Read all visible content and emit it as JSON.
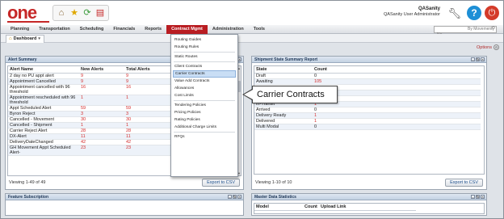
{
  "header": {
    "logo": "one",
    "user_name": "QASanity",
    "user_role": "QASanity User Administrator"
  },
  "menu": {
    "items": [
      "Planning",
      "Transportation",
      "Scheduling",
      "Financials",
      "Reports",
      "Contract Mgmt",
      "Administration",
      "Tools"
    ],
    "active": "Contract Mgmt",
    "search_placeholder": "By Movement No"
  },
  "tab": {
    "label": "Dashboard"
  },
  "options_label": "Options",
  "alert_summary": {
    "title": "Alert Summary",
    "columns": [
      "Alert Name",
      "New Alerts",
      "Total Alerts"
    ],
    "rows": [
      [
        "2 day no PU appt alert",
        "9",
        "9"
      ],
      [
        "Appointment Cancelled",
        "9",
        "9"
      ],
      [
        "Appointment cancelled with 96 threshold",
        "16",
        "16"
      ],
      [
        "Appointment rescheduled with 96 threshold",
        "1",
        "1"
      ],
      [
        "Appt Scheduled Alert",
        "59",
        "59"
      ],
      [
        "Byron Reject",
        "3",
        "3"
      ],
      [
        "Cancelled - Movement",
        "30",
        "30"
      ],
      [
        "Cancelled - Shipment",
        "1",
        "1"
      ],
      [
        "Carrier Reject Alert",
        "28",
        "28"
      ],
      [
        "DX-Alert",
        "11",
        "11"
      ],
      [
        "DeliveryDateChanged",
        "42",
        "42"
      ],
      [
        "GH Movement Appt Scheduled Alert-",
        "23",
        "23"
      ]
    ],
    "viewing": "Viewing 1-49 of 49",
    "export": "Export to CSV"
  },
  "shipment_summary": {
    "title": "Shipment State Summary Report",
    "columns": [
      "State",
      "Count"
    ],
    "rows": [
      [
        "Draft",
        "0"
      ],
      [
        "Awaiting",
        "105"
      ],
      [
        "",
        ""
      ],
      [
        "",
        ""
      ],
      [
        "",
        ""
      ],
      [
        "In-Transit",
        "1"
      ],
      [
        "Arrived",
        "0"
      ],
      [
        "Delivery Ready",
        "1"
      ],
      [
        "Delivered",
        "1"
      ],
      [
        "Multi Modal",
        "0"
      ]
    ],
    "viewing": "Viewing 1-10 of 10",
    "export": "Export to CSV"
  },
  "feature_subscription": {
    "title": "Feature Subscription"
  },
  "master_data": {
    "title": "Master Data Statistics",
    "columns": [
      "Model",
      "Count",
      "Upload Link"
    ]
  },
  "dropdown": {
    "items": [
      {
        "label": "Routing Guides",
        "sep_after": false
      },
      {
        "label": "Routing Rules",
        "sep_after": true
      },
      {
        "label": "Static Routes",
        "sep_after": true
      },
      {
        "label": "Client Contracts",
        "sep_after": false
      },
      {
        "label": "Carrier Contracts",
        "sep_after": false,
        "selected": true
      },
      {
        "label": "Value Add Contracts",
        "sep_after": false
      },
      {
        "label": "Allowances",
        "sep_after": false
      },
      {
        "label": "Cost Limits",
        "sep_after": true
      },
      {
        "label": "Tendering Policies",
        "sep_after": false
      },
      {
        "label": "Pricing Policies",
        "sep_after": false
      },
      {
        "label": "Rating Policies",
        "sep_after": false
      },
      {
        "label": "Additional Charge Limits",
        "sep_after": true
      },
      {
        "label": "RFQs",
        "sep_after": false
      }
    ]
  },
  "callout": {
    "text": "Carrier Contracts"
  },
  "colors": {
    "brand": "#c62828",
    "active_menu": "#b91d22",
    "alert_red": "#d42a2a"
  }
}
